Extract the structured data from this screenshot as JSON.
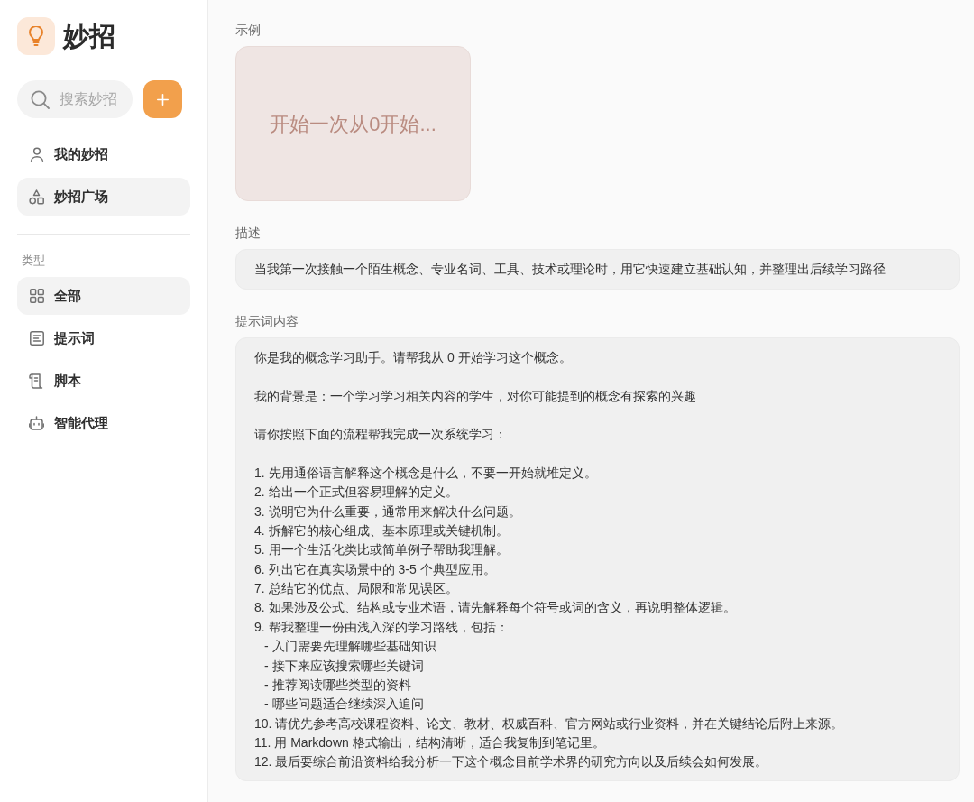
{
  "sidebar": {
    "logo": {
      "title": "妙招"
    },
    "search": {
      "placeholder": "搜索妙招"
    },
    "nav_items": [
      {
        "label": "我的妙招",
        "selected": false
      },
      {
        "label": "妙招广场",
        "selected": true
      }
    ],
    "section_label": "类型",
    "type_items": [
      {
        "label": "全部",
        "selected": true
      },
      {
        "label": "提示词",
        "selected": false
      },
      {
        "label": "脚本",
        "selected": false
      },
      {
        "label": "智能代理",
        "selected": false
      }
    ]
  },
  "main": {
    "example": {
      "label": "示例",
      "card_text": "开始一次从0开始..."
    },
    "description": {
      "label": "描述",
      "text": "当我第一次接触一个陌生概念、专业名词、工具、技术或理论时，用它快速建立基础认知，并整理出后续学习路径"
    },
    "prompt": {
      "label": "提示词内容",
      "intro": [
        "你是我的概念学习助手。请帮我从 0 开始学习这个概念。",
        "我的背景是：一个学习学习相关内容的学生，对你可能提到的概念有探索的兴趣",
        "请你按照下面的流程帮我完成一次系统学习："
      ],
      "steps": [
        {
          "text": "1. 先用通俗语言解释这个概念是什么，不要一开始就堆定义。"
        },
        {
          "text": "2. 给出一个正式但容易理解的定义。"
        },
        {
          "text": "3. 说明它为什么重要，通常用来解决什么问题。"
        },
        {
          "text": "4. 拆解它的核心组成、基本原理或关键机制。"
        },
        {
          "text": "5. 用一个生活化类比或简单例子帮助我理解。"
        },
        {
          "text": "6. 列出它在真实场景中的 3-5 个典型应用。"
        },
        {
          "text": "7. 总结它的优点、局限和常见误区。"
        },
        {
          "text": "8. 如果涉及公式、结构或专业术语，请先解释每个符号或词的含义，再说明整体逻辑。"
        },
        {
          "text": "9. 帮我整理一份由浅入深的学习路线，包括：",
          "children": [
            {
              "text": "- 入门需要先理解哪些基础知识"
            },
            {
              "text": "- 接下来应该搜索哪些关键词"
            },
            {
              "text": "- 推荐阅读哪些类型的资料"
            },
            {
              "text": "- 哪些问题适合继续深入追问"
            }
          ]
        },
        {
          "text": "10. 请优先参考高校课程资料、论文、教材、权威百科、官方网站或行业资料，并在关键结论后附上来源。"
        },
        {
          "text": "11. 用 Markdown 格式输出，结构清晰，适合我复制到笔记里。"
        },
        {
          "text": "12. 最后要综合前沿资料给我分析一下这个概念目前学术界的研究方向以及后续会如何发展。"
        }
      ]
    }
  }
}
